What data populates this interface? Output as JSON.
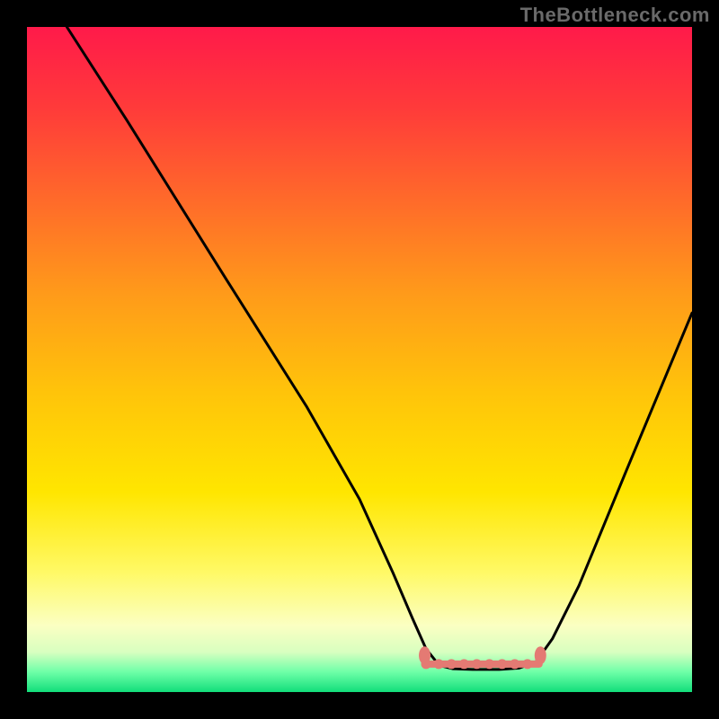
{
  "watermark": "TheBottleneck.com",
  "colors": {
    "background": "#000000",
    "curve_stroke": "#000000",
    "curve_stroke_width": 3,
    "marker_fill": "#e47a73",
    "marker_radius": 10,
    "marker_inner_radius": 4,
    "marker_inner_fill": "#b84a40",
    "gradient_stops": [
      {
        "pct": 0,
        "color": "#ff1a4a"
      },
      {
        "pct": 12,
        "color": "#ff3a3a"
      },
      {
        "pct": 26,
        "color": "#ff6a2a"
      },
      {
        "pct": 40,
        "color": "#ff9a1a"
      },
      {
        "pct": 55,
        "color": "#ffc40a"
      },
      {
        "pct": 70,
        "color": "#ffe600"
      },
      {
        "pct": 82,
        "color": "#fff966"
      },
      {
        "pct": 90,
        "color": "#fbffc2"
      },
      {
        "pct": 94,
        "color": "#d8ffc0"
      },
      {
        "pct": 97,
        "color": "#6effa8"
      },
      {
        "pct": 100,
        "color": "#12de7a"
      }
    ]
  },
  "chart_data": {
    "type": "line",
    "title": "",
    "xlabel": "",
    "ylabel": "",
    "xlim": [
      0,
      100
    ],
    "ylim": [
      0,
      100
    ],
    "grid": false,
    "curve_points": [
      {
        "x": 6,
        "y": 100
      },
      {
        "x": 15,
        "y": 86
      },
      {
        "x": 30,
        "y": 62
      },
      {
        "x": 42,
        "y": 43
      },
      {
        "x": 50,
        "y": 29
      },
      {
        "x": 55,
        "y": 18
      },
      {
        "x": 58,
        "y": 11
      },
      {
        "x": 60,
        "y": 6.5
      },
      {
        "x": 62,
        "y": 4
      },
      {
        "x": 64,
        "y": 3.5
      },
      {
        "x": 67,
        "y": 3.4
      },
      {
        "x": 71,
        "y": 3.4
      },
      {
        "x": 74,
        "y": 3.6
      },
      {
        "x": 76.5,
        "y": 4.5
      },
      {
        "x": 79,
        "y": 8
      },
      {
        "x": 83,
        "y": 16
      },
      {
        "x": 90,
        "y": 33
      },
      {
        "x": 100,
        "y": 57
      }
    ],
    "flat_segment": {
      "start": {
        "x": 60,
        "y": 4.2
      },
      "end": {
        "x": 77,
        "y": 4.2
      }
    },
    "markers": [
      {
        "x": 59.8,
        "y": 5.5
      },
      {
        "x": 77.2,
        "y": 5.5
      }
    ]
  }
}
